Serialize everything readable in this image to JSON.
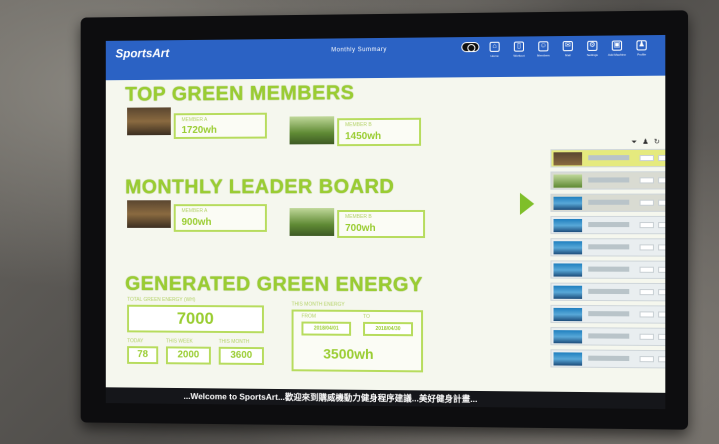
{
  "app": {
    "brand": "SportsArt",
    "title": "Monthly Summary"
  },
  "nav": [
    {
      "label": "",
      "icon": "toggle-icon"
    },
    {
      "label": "Home",
      "icon": "home-icon"
    },
    {
      "label": "Workout",
      "icon": "device-icon"
    },
    {
      "label": "Members",
      "icon": "members-icon"
    },
    {
      "label": "Mail",
      "icon": "mail-icon"
    },
    {
      "label": "Settings",
      "icon": "settings-icon"
    },
    {
      "label": "Add Machine",
      "icon": "machine-icon"
    },
    {
      "label": "Profile",
      "icon": "user-icon"
    }
  ],
  "top_green": {
    "heading": "TOP GREEN MEMBERS",
    "cards": [
      {
        "name": "MEMBER A",
        "value": "1720wh"
      },
      {
        "name": "MEMBER B",
        "value": "1450wh"
      }
    ]
  },
  "monthly": {
    "heading": "MONTHLY LEADER BOARD",
    "cards": [
      {
        "name": "MEMBER A",
        "value": "900wh"
      },
      {
        "name": "MEMBER B",
        "value": "700wh"
      }
    ]
  },
  "generated": {
    "heading": "GENERATED GREEN ENERGY",
    "total_label": "TOTAL GREEN ENERGY (WH)",
    "total_value": "7000",
    "small_stats": [
      {
        "label": "TODAY",
        "value": "78"
      },
      {
        "label": "THIS WEEK",
        "value": "2000"
      },
      {
        "label": "THIS MONTH",
        "value": "3600"
      }
    ],
    "month_label": "THIS MONTH ENERGY",
    "month_fields": [
      {
        "label": "FROM",
        "value": "2018/04/01"
      },
      {
        "label": "TO",
        "value": "2018/04/30"
      }
    ],
    "month_value": "3500wh"
  },
  "ticker": {
    "text": "...Welcome to SportsArt...歡迎來到購威機動力健身程序建議...美好健身計畫..."
  }
}
